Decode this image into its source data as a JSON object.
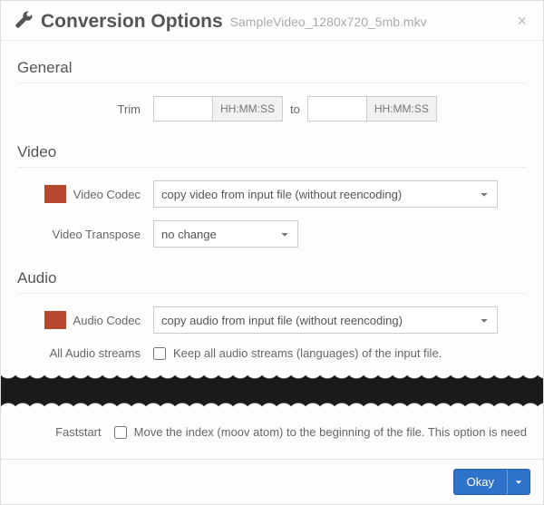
{
  "header": {
    "title": "Conversion Options",
    "filename": "SampleVideo_1280x720_5mb.mkv"
  },
  "general": {
    "section": "General",
    "trim_label": "Trim",
    "start_placeholder": "HH:MM:SS",
    "end_placeholder": "HH:MM:SS",
    "to_label": "to"
  },
  "video": {
    "section": "Video",
    "codec_label": "Video Codec",
    "codec_value": "copy video from input file (without reencoding)",
    "transpose_label": "Video Transpose",
    "transpose_value": "no change"
  },
  "audio": {
    "section": "Audio",
    "codec_label": "Audio Codec",
    "codec_value": "copy audio from input file (without reencoding)",
    "allstreams_label": "All Audio streams",
    "allstreams_text": "Keep all audio streams (languages) of the input file."
  },
  "faststart": {
    "label": "Faststart",
    "text": "Move the index (moov atom) to the beginning of the file. This option is need"
  },
  "footer": {
    "okay": "Okay"
  }
}
